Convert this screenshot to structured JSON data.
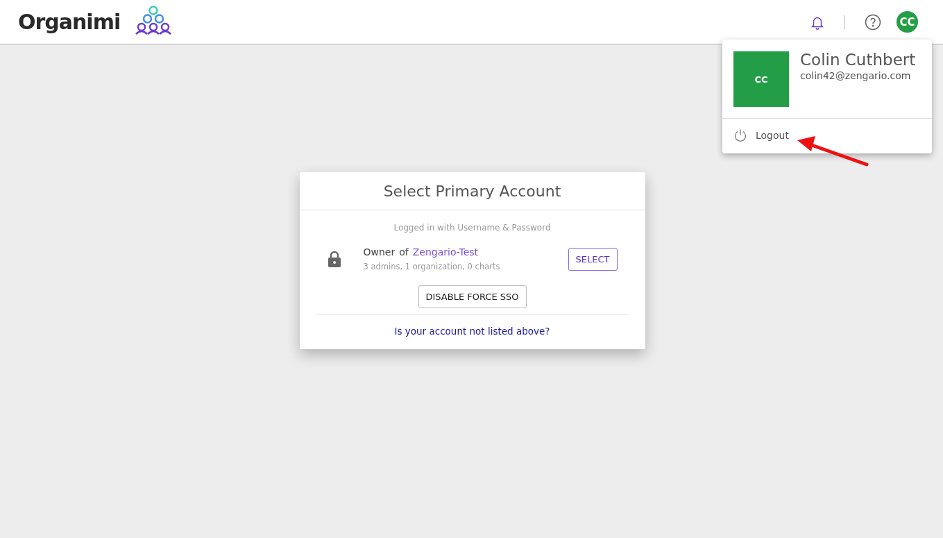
{
  "header": {
    "logo": "Organimi",
    "avatar_initials": "CC"
  },
  "user_menu": {
    "avatar_initials": "CC",
    "name": "Colin Cuthbert",
    "email": "colin42@zengario.com",
    "items": [
      {
        "label": "Logout"
      }
    ]
  },
  "dialog": {
    "title": "Select Primary Account",
    "login_method": "Logged in with Username & Password",
    "accounts": [
      {
        "role": "Owner",
        "connector": "of",
        "organization": "Zengario-Test",
        "summary": "3 admins, 1 organization, 0 charts",
        "button": "SELECT"
      }
    ],
    "secondary_button": "DISABLE FORCE SSO",
    "link": "Is your account not listed above?"
  }
}
